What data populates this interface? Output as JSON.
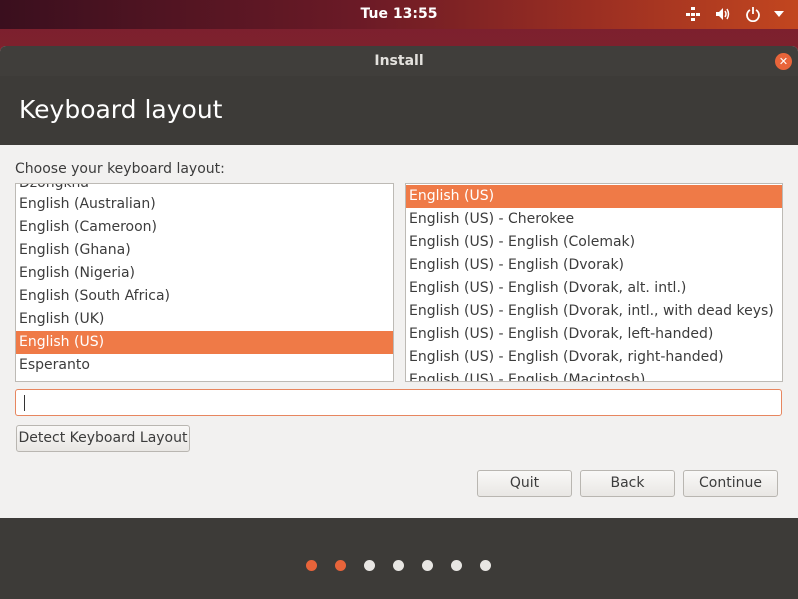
{
  "topbar": {
    "clock": "Tue 13:55",
    "tray_icons": [
      "network-icon",
      "volume-icon",
      "power-icon",
      "caret-down-icon"
    ]
  },
  "window": {
    "title": "Install",
    "page_title": "Keyboard layout",
    "prompt": "Choose your keyboard layout:",
    "layouts": [
      "Dzongkha",
      "English (Australian)",
      "English (Cameroon)",
      "English (Ghana)",
      "English (Nigeria)",
      "English (South Africa)",
      "English (UK)",
      "English (US)",
      "Esperanto"
    ],
    "selected_layout": "English (US)",
    "variants": [
      "English (US)",
      "English (US) - Cherokee",
      "English (US) - English (Colemak)",
      "English (US) - English (Dvorak)",
      "English (US) - English (Dvorak, alt. intl.)",
      "English (US) - English (Dvorak, intl., with dead keys)",
      "English (US) - English (Dvorak, left-handed)",
      "English (US) - English (Dvorak, right-handed)",
      "English (US) - English (Macintosh)"
    ],
    "selected_variant": "English (US)",
    "test_input": {
      "value": "",
      "placeholder": ""
    },
    "buttons": {
      "detect": "Detect Keyboard Layout",
      "quit": "Quit",
      "back": "Back",
      "continue": "Continue"
    }
  },
  "progress": {
    "total_steps": 7,
    "current_step": 2
  },
  "colors": {
    "accent": "#e8643a",
    "selected_row": "#ef7a47",
    "header": "#3d3b38"
  }
}
